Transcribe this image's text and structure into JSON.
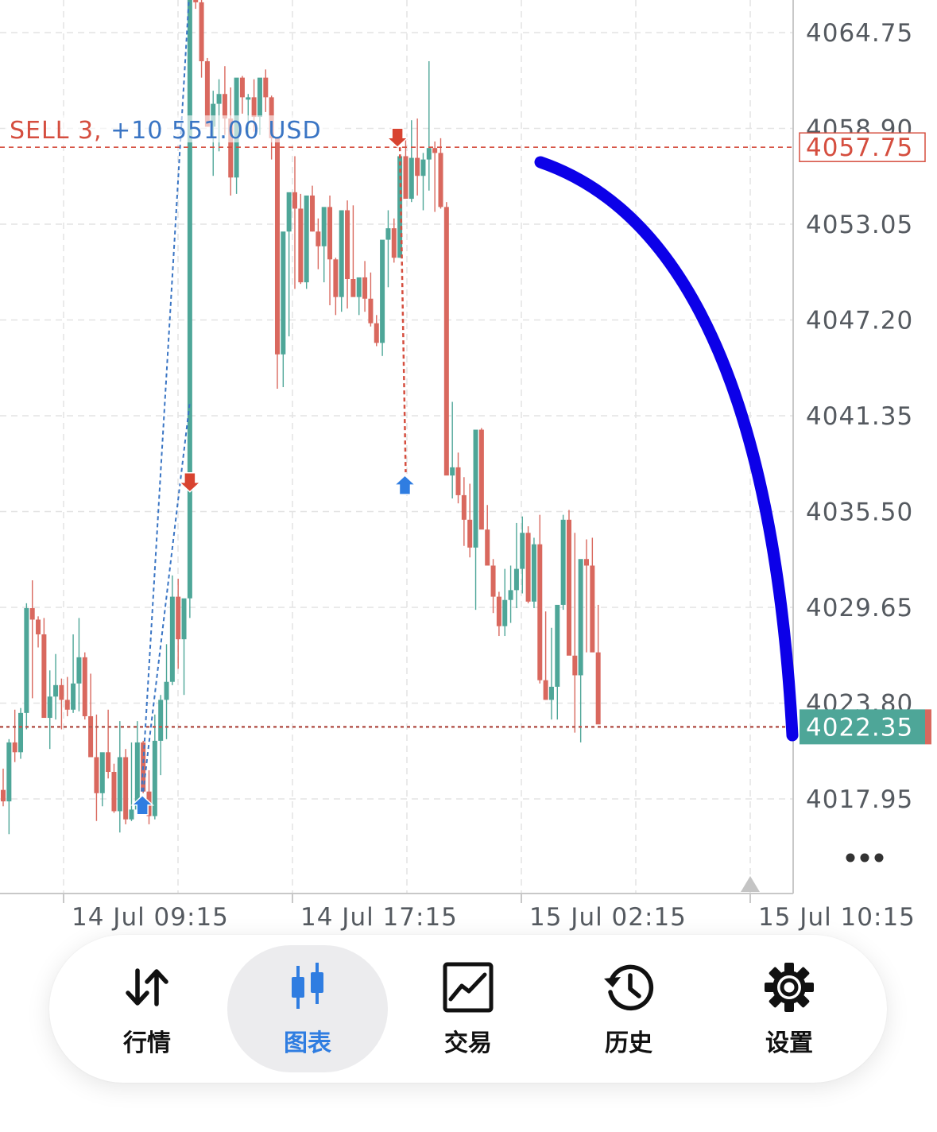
{
  "chart_data": {
    "type": "candlestick",
    "y_ticks": [
      "4064.75",
      "4058.90",
      "4053.05",
      "4047.20",
      "4041.35",
      "4035.50",
      "4029.65",
      "4023.80",
      "4017.95"
    ],
    "x_ticks": [
      "14 Jul 09:15",
      "14 Jul 17:15",
      "15 Jul 02:15",
      "15 Jul 10:15"
    ],
    "ylim": [
      4014.0,
      4067.0
    ],
    "grid": true,
    "candles_ohlc": [
      [
        4018.5,
        4019.8,
        4017.5,
        4017.8
      ],
      [
        4017.8,
        4021.6,
        4015.8,
        4021.4
      ],
      [
        4021.4,
        4023.4,
        4020.2,
        4020.8
      ],
      [
        4020.8,
        4023.5,
        4020.4,
        4023.2
      ],
      [
        4023.2,
        4029.9,
        4022.2,
        4029.6
      ],
      [
        4029.6,
        4031.3,
        4024.1,
        4028.9
      ],
      [
        4028.9,
        4029.1,
        4027.2,
        4028.0
      ],
      [
        4028.0,
        4029.0,
        4024.2,
        4022.9
      ],
      [
        4022.9,
        4025.8,
        4021.0,
        4024.2
      ],
      [
        4024.2,
        4026.8,
        4022.8,
        4024.9
      ],
      [
        4024.9,
        4025.3,
        4022.2,
        4024.0
      ],
      [
        4024.0,
        4025.4,
        4023.0,
        4023.4
      ],
      [
        4023.4,
        4028.0,
        4023.2,
        4025.0
      ],
      [
        4025.0,
        4029.0,
        4023.3,
        4026.6
      ],
      [
        4026.6,
        4026.9,
        4022.8,
        4023.0
      ],
      [
        4023.0,
        4025.6,
        4021.3,
        4020.5
      ],
      [
        4020.5,
        4023.1,
        4016.6,
        4018.3
      ],
      [
        4018.3,
        4019.4,
        4017.5,
        4020.8
      ],
      [
        4020.8,
        4023.4,
        4019.2,
        4019.6
      ],
      [
        4019.6,
        4020.1,
        4017.1,
        4017.2
      ],
      [
        4017.2,
        4022.7,
        4015.9,
        4020.5
      ],
      [
        4020.5,
        4021.0,
        4016.4,
        4016.7
      ],
      [
        4016.7,
        4021.4,
        4016.6,
        4017.3
      ],
      [
        4017.3,
        4022.7,
        4017.2,
        4021.4
      ],
      [
        4021.4,
        4021.5,
        4018.3,
        4018.4
      ],
      [
        4018.4,
        4019.7,
        4016.4,
        4016.9
      ],
      [
        4016.9,
        4023.1,
        4016.7,
        4021.5
      ],
      [
        4021.5,
        4024.3,
        4019.4,
        4024.0
      ],
      [
        4024.0,
        4027.4,
        4021.6,
        4025.1
      ],
      [
        4025.1,
        4031.6,
        4024.9,
        4030.3
      ],
      [
        4030.3,
        4031.4,
        4025.9,
        4027.7
      ],
      [
        4027.7,
        4029.8,
        4024.3,
        4030.2
      ],
      [
        4030.2,
        4067.3,
        4029.0,
        4067.0
      ],
      [
        4067.0,
        4067.3,
        4066.2,
        4066.6
      ],
      [
        4066.6,
        4067.1,
        4062.0,
        4063.0
      ],
      [
        4063.0,
        4063.2,
        4059.0,
        4059.0
      ],
      [
        4059.0,
        4061.2,
        4056.0,
        4060.4
      ],
      [
        4060.4,
        4061.9,
        4057.5,
        4061.0
      ],
      [
        4061.0,
        4062.7,
        4058.5,
        4059.5
      ],
      [
        4059.5,
        4061.4,
        4054.8,
        4055.9
      ],
      [
        4055.9,
        4059.0,
        4054.9,
        4062.0
      ],
      [
        4062.0,
        4062.1,
        4059.8,
        4060.8
      ],
      [
        4060.8,
        4061.0,
        4058.6,
        4060.8
      ],
      [
        4060.8,
        4061.9,
        4058.7,
        4059.6
      ],
      [
        4059.6,
        4061.1,
        4058.5,
        4062.0
      ],
      [
        4062.0,
        4062.5,
        4059.9,
        4060.8
      ],
      [
        4060.8,
        4060.9,
        4057.0,
        4058.3
      ],
      [
        4058.3,
        4058.4,
        4043.0,
        4045.1
      ],
      [
        4045.1,
        4052.2,
        4043.1,
        4052.6
      ],
      [
        4052.6,
        4053.9,
        4046.2,
        4055.0
      ],
      [
        4055.0,
        4057.2,
        4049.1,
        4054.0
      ],
      [
        4054.0,
        4054.9,
        4049.4,
        4049.5
      ],
      [
        4049.5,
        4053.2,
        4049.1,
        4054.8
      ],
      [
        4054.8,
        4055.4,
        4052.6,
        4052.6
      ],
      [
        4052.6,
        4053.4,
        4050.3,
        4051.7
      ],
      [
        4051.7,
        4052.2,
        4049.5,
        4054.1
      ],
      [
        4054.1,
        4054.8,
        4048.1,
        4050.9
      ],
      [
        4050.9,
        4051.0,
        4047.5,
        4048.6
      ],
      [
        4048.6,
        4049.9,
        4047.7,
        4053.9
      ],
      [
        4053.9,
        4054.5,
        4047.9,
        4049.7
      ],
      [
        4049.7,
        4054.2,
        4048.7,
        4048.6
      ],
      [
        4048.6,
        4049.6,
        4047.5,
        4049.8
      ],
      [
        4049.8,
        4050.8,
        4047.7,
        4048.5
      ],
      [
        4048.5,
        4050.1,
        4046.8,
        4047.0
      ],
      [
        4047.0,
        4047.5,
        4045.6,
        4045.8
      ],
      [
        4045.8,
        4049.5,
        4045.0,
        4052.1
      ],
      [
        4052.1,
        4053.9,
        4049.2,
        4052.8
      ],
      [
        4052.8,
        4053.4,
        4050.7,
        4051.0
      ],
      [
        4051.0,
        4052.8,
        4051.0,
        4057.2
      ],
      [
        4057.2,
        4058.3,
        4055.4,
        4054.6
      ],
      [
        4054.6,
        4059.4,
        4054.4,
        4057.1
      ],
      [
        4057.1,
        4059.5,
        4054.8,
        4056.0
      ],
      [
        4056.0,
        4057.4,
        4053.9,
        4057.0
      ],
      [
        4057.0,
        4063.0,
        4055.1,
        4057.7
      ],
      [
        4057.7,
        4058.1,
        4053.8,
        4057.4
      ],
      [
        4057.4,
        4058.3,
        4054.0,
        4054.1
      ],
      [
        4054.1,
        4054.4,
        4049.9,
        4037.7
      ],
      [
        4037.7,
        4042.2,
        4036.3,
        4038.2
      ],
      [
        4038.2,
        4039.1,
        4036.0,
        4036.5
      ],
      [
        4036.5,
        4037.6,
        4033.4,
        4035.0
      ],
      [
        4035.0,
        4037.2,
        4032.7,
        4033.3
      ],
      [
        4033.3,
        4040.2,
        4029.5,
        4040.5
      ],
      [
        4040.5,
        4040.6,
        4034.9,
        4034.4
      ],
      [
        4034.4,
        4035.9,
        4033.8,
        4032.2
      ],
      [
        4032.2,
        4032.6,
        4029.3,
        4030.3
      ],
      [
        4030.3,
        4030.6,
        4027.9,
        4028.5
      ],
      [
        4028.5,
        4032.0,
        4027.9,
        4030.1
      ],
      [
        4030.1,
        4032.2,
        4028.7,
        4030.7
      ],
      [
        4030.7,
        4034.8,
        4029.6,
        4032.0
      ],
      [
        4032.0,
        4035.2,
        4030.5,
        4034.2
      ],
      [
        4034.2,
        4034.6,
        4029.9,
        4030.0
      ],
      [
        4030.0,
        4033.9,
        4029.6,
        4033.5
      ],
      [
        4033.5,
        4035.3,
        4025.0,
        4025.2
      ],
      [
        4025.2,
        4029.4,
        4024.0,
        4024.0
      ],
      [
        4024.0,
        4028.4,
        4022.8,
        4024.8
      ],
      [
        4024.8,
        4029.4,
        4022.8,
        4029.8
      ],
      [
        4029.8,
        4035.3,
        4029.5,
        4035.0
      ],
      [
        4035.0,
        4035.6,
        4028.9,
        4026.7
      ],
      [
        4026.7,
        4034.2,
        4022.0,
        4025.5
      ],
      [
        4025.5,
        4029.9,
        4021.4,
        4032.6
      ],
      [
        4032.6,
        4033.8,
        4026.9,
        4032.2
      ],
      [
        4032.2,
        4033.9,
        4029.0,
        4026.9
      ],
      [
        4026.9,
        4029.8,
        4023.9,
        4022.5
      ]
    ],
    "trades": [
      {
        "side": "buy",
        "candle": 24
      },
      {
        "side": "sell",
        "candle": 32
      },
      {
        "side": "sell",
        "candle": 68
      },
      {
        "side": "buy",
        "candle": 69
      }
    ],
    "position_line": {
      "price": 4057.75,
      "label": "SELL 3, +10 551.00 USD",
      "badge": "4057.75"
    },
    "current_price": {
      "price": 4022.35,
      "badge": "4022.35"
    },
    "menu_icon": "more-dots-icon",
    "scroll_marker_icon": "triangle-up-icon",
    "colors": {
      "up": "#4ea698",
      "down": "#d9685e",
      "position": "#d54e3f",
      "label_blue": "#3a75c4",
      "current_badge": "#4ea698",
      "grid": "#e3e3e3",
      "annotation": "#0c00e8",
      "buy_arrow": "#2f7de1",
      "sell_arrow": "#d84330"
    }
  },
  "annotation": {
    "type": "hand-drawn-curve",
    "color": "#0c00e8"
  },
  "nav": {
    "items": [
      {
        "label": "行情",
        "icon": "quotes-arrows-icon",
        "active": false
      },
      {
        "label": "图表",
        "icon": "candlestick-icon",
        "active": true
      },
      {
        "label": "交易",
        "icon": "trade-chart-icon",
        "active": false
      },
      {
        "label": "历史",
        "icon": "history-clock-icon",
        "active": false
      },
      {
        "label": "设置",
        "icon": "gear-icon",
        "active": false
      }
    ]
  }
}
